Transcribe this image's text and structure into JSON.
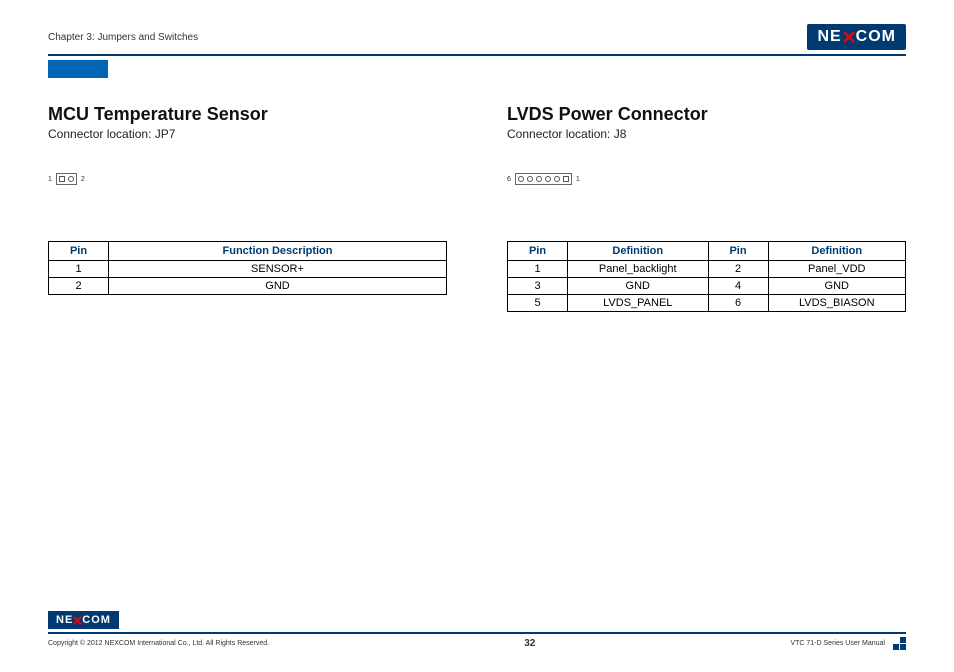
{
  "header": {
    "chapter": "Chapter 3: Jumpers and Switches",
    "logo": "NEXCOM"
  },
  "left": {
    "title": "MCU Temperature Sensor",
    "subtitle": "Connector location: JP7",
    "diagram": {
      "left_label": "1",
      "right_label": "2"
    },
    "table": {
      "headers": [
        "Pin",
        "Function Description"
      ],
      "rows": [
        [
          "1",
          "SENSOR+"
        ],
        [
          "2",
          "GND"
        ]
      ]
    }
  },
  "right": {
    "title": "LVDS Power Connector",
    "subtitle": "Connector location: J8",
    "diagram": {
      "left_label": "6",
      "right_label": "1"
    },
    "table": {
      "headers": [
        "Pin",
        "Definition",
        "Pin",
        "Definition"
      ],
      "rows": [
        [
          "1",
          "Panel_backlight",
          "2",
          "Panel_VDD"
        ],
        [
          "3",
          "GND",
          "4",
          "GND"
        ],
        [
          "5",
          "LVDS_PANEL",
          "6",
          "LVDS_BIASON"
        ]
      ]
    }
  },
  "footer": {
    "logo": "NEXCOM",
    "copyright": "Copyright © 2012 NEXCOM International Co., Ltd. All Rights Reserved.",
    "page": "32",
    "manual": "VTC 71-D Series User Manual"
  }
}
